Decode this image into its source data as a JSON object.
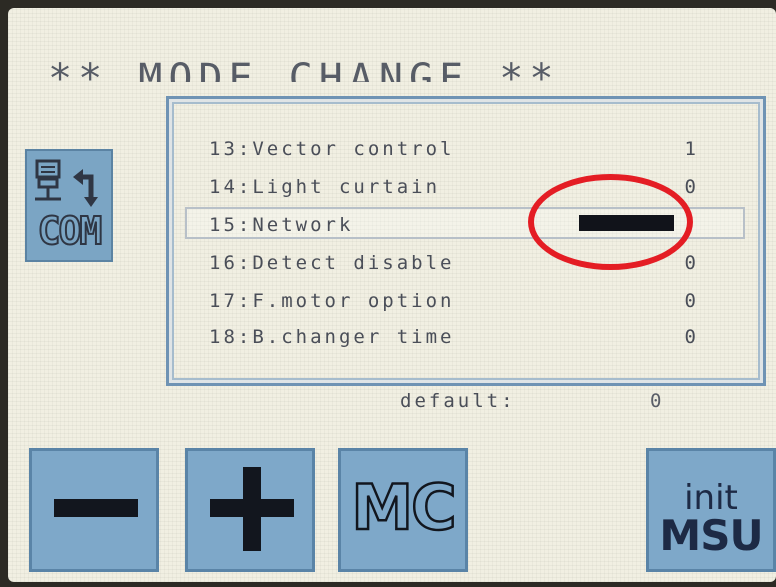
{
  "header": {
    "title": "** MODE CHANGE **"
  },
  "com_icon": {
    "label": "COM",
    "icon": "network-swap-icon"
  },
  "menu": {
    "items": [
      {
        "label": "13:Vector control",
        "value": "1"
      },
      {
        "label": "14:Light curtain",
        "value": "0"
      },
      {
        "label": "15:Network",
        "value": ""
      },
      {
        "label": "16:Detect disable",
        "value": "0"
      },
      {
        "label": "17:F.motor option",
        "value": "0"
      },
      {
        "label": "18:B.changer time",
        "value": "0"
      }
    ],
    "selected_index": 2
  },
  "default": {
    "label": "default:",
    "value": "0"
  },
  "buttons": {
    "minus": {
      "icon": "minus-icon"
    },
    "plus": {
      "icon": "plus-icon"
    },
    "mc": {
      "label": "MC"
    },
    "init": {
      "line1": "init",
      "line2": "MSU"
    }
  },
  "annotation": {
    "color": "#e41d24"
  }
}
